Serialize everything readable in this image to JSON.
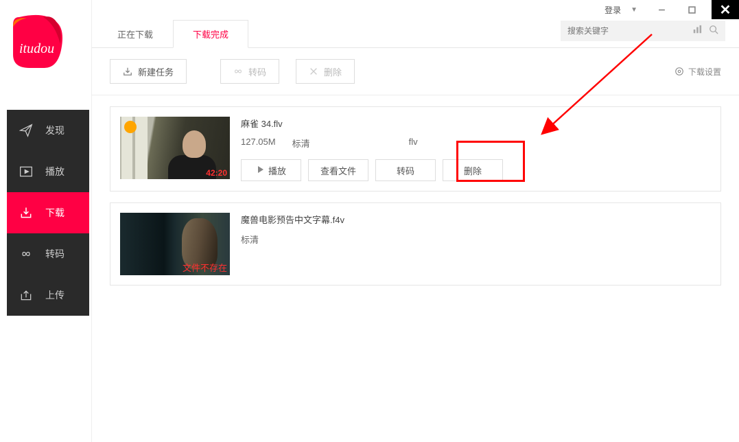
{
  "topbar": {
    "login": "登录"
  },
  "logo": {
    "text": "itudou"
  },
  "sidebar": {
    "items": [
      {
        "label": "发现"
      },
      {
        "label": "播放"
      },
      {
        "label": "下载"
      },
      {
        "label": "转码"
      },
      {
        "label": "上传"
      }
    ]
  },
  "tabs": [
    {
      "label": "正在下载"
    },
    {
      "label": "下载完成"
    }
  ],
  "search": {
    "placeholder": "搜索关键字"
  },
  "toolbar": {
    "new_task": "新建任务",
    "transcode": "转码",
    "delete": "删除",
    "settings": "下载设置"
  },
  "items": [
    {
      "filename": "麻雀 34.flv",
      "size": "127.05M",
      "quality": "标清",
      "format": "flv",
      "duration": "42:20",
      "actions": {
        "play": "播放",
        "view": "查看文件",
        "transcode": "转码",
        "delete": "删除"
      }
    },
    {
      "filename": "魔兽电影预告中文字幕.f4v",
      "quality": "标清",
      "error": "文件不存在"
    }
  ]
}
